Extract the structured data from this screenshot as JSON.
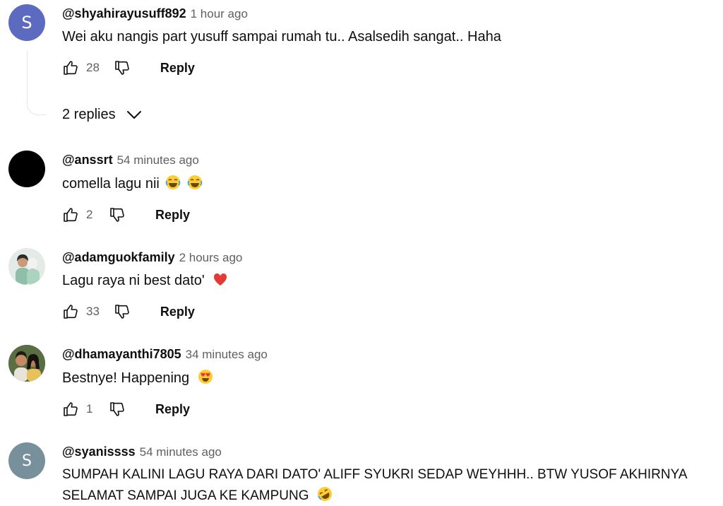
{
  "comments": [
    {
      "author": "@shyahirayusuff892",
      "time": "1 hour ago",
      "text": "Wei aku nangis part yusuff sampai rumah tu.. Asalsedih sangat.. Haha",
      "likes": "28",
      "reply_label": "Reply",
      "avatar_letter": "S",
      "avatar_color": "#5c6bc0"
    },
    {
      "author": "@anssrt",
      "time": "54 minutes ago",
      "text": "comella lagu nii",
      "likes": "2",
      "reply_label": "Reply",
      "avatar_color": "#000000"
    },
    {
      "author": "@adamguokfamily",
      "time": "2 hours ago",
      "text": "Lagu raya ni best dato'",
      "likes": "33",
      "reply_label": "Reply"
    },
    {
      "author": "@dhamayanthi7805",
      "time": "34 minutes ago",
      "text": "Bestnye! Happening",
      "likes": "1",
      "reply_label": "Reply"
    },
    {
      "author": "@syanissss",
      "time": "54 minutes ago",
      "text": "SUMPAH KALINI LAGU RAYA DARI DATO' ALIFF SYUKRI SEDAP WEYHHH.. BTW YUSOF AKHIRNYA SELAMAT SAMPAI JUGA KE KAMPUNG",
      "avatar_letter": "S",
      "avatar_color": "#78909c"
    }
  ],
  "replies_toggle": {
    "label": "2 replies"
  },
  "icons": {
    "like": "thumbs-up-icon",
    "dislike": "thumbs-down-icon",
    "expand": "chevron-down-icon",
    "emoji_laugh": "face-with-tears-of-joy-emoji",
    "emoji_heart": "red-heart-emoji",
    "emoji_hearteyes": "heart-eyes-emoji",
    "emoji_rofl": "rolling-on-floor-laughing-emoji"
  }
}
